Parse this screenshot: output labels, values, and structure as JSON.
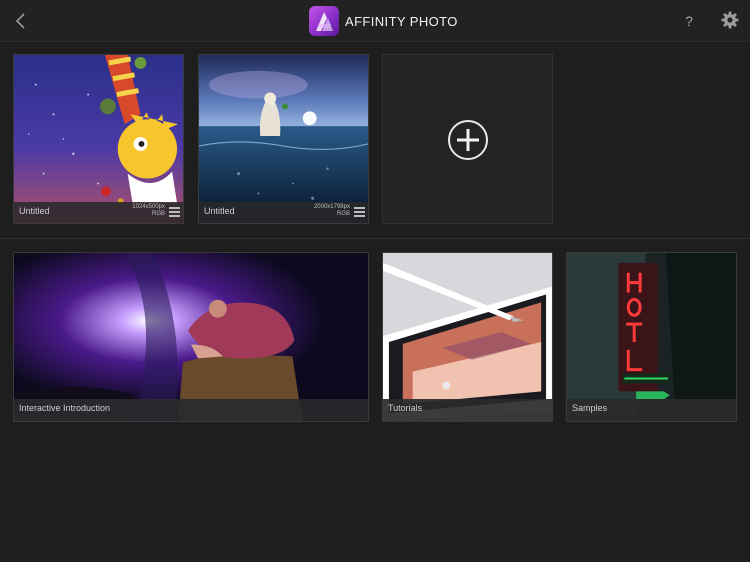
{
  "header": {
    "title": "AFFINITY PHOTO",
    "help_label": "?"
  },
  "documents": [
    {
      "name": "Untitled",
      "dims": "1024x500px",
      "mode": "RGB"
    },
    {
      "name": "Untitled",
      "dims": "2000x1798px",
      "mode": "RGB"
    }
  ],
  "resources": [
    {
      "label": "Interactive Introduction"
    },
    {
      "label": "Tutorials"
    },
    {
      "label": "Samples"
    }
  ],
  "colors": {
    "background": "#1e1e1f",
    "accent": "#a040d8"
  }
}
